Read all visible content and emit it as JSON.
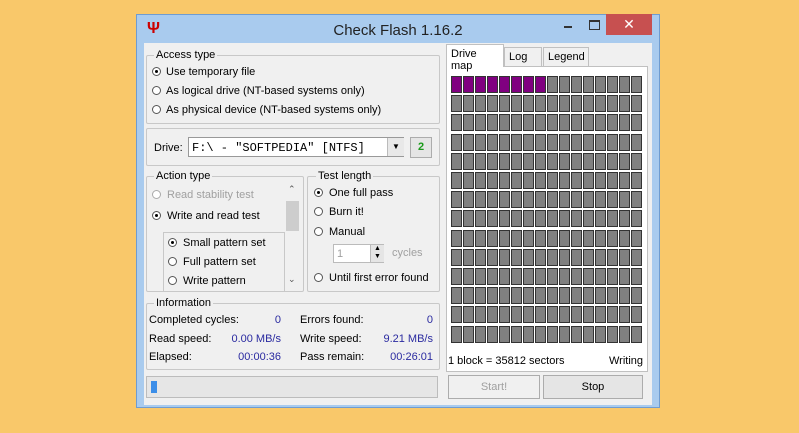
{
  "window": {
    "title": "Check Flash 1.16.2",
    "minimize_icon": "minimize-icon",
    "maximize_icon": "maximize-icon",
    "close_icon": "close-icon",
    "app_icon": "usb-icon"
  },
  "access_type": {
    "legend": "Access type",
    "options": [
      {
        "label": "Use temporary file",
        "selected": true
      },
      {
        "label": "As logical drive (NT-based systems only)",
        "selected": false
      },
      {
        "label": "As physical device (NT-based systems only)",
        "selected": false
      }
    ]
  },
  "drive": {
    "label": "Drive:",
    "value": "F:\\ - \"SOFTPEDIA\" [NTFS]",
    "refresh_icon": "refresh-icon"
  },
  "action_type": {
    "legend": "Action type",
    "options": [
      {
        "label": "Read stability test",
        "disabled": true
      },
      {
        "label": "Write and read test",
        "selected": true
      }
    ],
    "sub_options": [
      {
        "label": "Small pattern set",
        "selected": true
      },
      {
        "label": "Full pattern set"
      },
      {
        "label": "Write pattern"
      }
    ]
  },
  "test_length": {
    "legend": "Test length",
    "options": [
      {
        "label": "One full pass",
        "selected": true
      },
      {
        "label": "Burn it!"
      },
      {
        "label": "Manual"
      }
    ],
    "cycles_value": "1",
    "cycles_label": "cycles",
    "until_error": "Until first error found"
  },
  "information": {
    "legend": "Information",
    "completed_cycles_label": "Completed cycles:",
    "completed_cycles": "0",
    "errors_label": "Errors found:",
    "errors": "0",
    "read_speed_label": "Read speed:",
    "read_speed": "0.00 MB/s",
    "write_speed_label": "Write speed:",
    "write_speed": "9.21 MB/s",
    "elapsed_label": "Elapsed:",
    "elapsed": "00:00:36",
    "pass_remain_label": "Pass remain:",
    "pass_remain": "00:26:01"
  },
  "progress": {
    "percent": 2
  },
  "tabs": [
    {
      "label": "Drive map",
      "active": true
    },
    {
      "label": "Log"
    },
    {
      "label": "Legend"
    }
  ],
  "drive_map": {
    "columns": 16,
    "rows": 14,
    "written_blocks": 8,
    "colors": {
      "written": "#800080",
      "pending": "#808080"
    },
    "block_info": "1 block = 35812 sectors",
    "status": "Writing"
  },
  "buttons": {
    "start": "Start!",
    "stop": "Stop"
  }
}
